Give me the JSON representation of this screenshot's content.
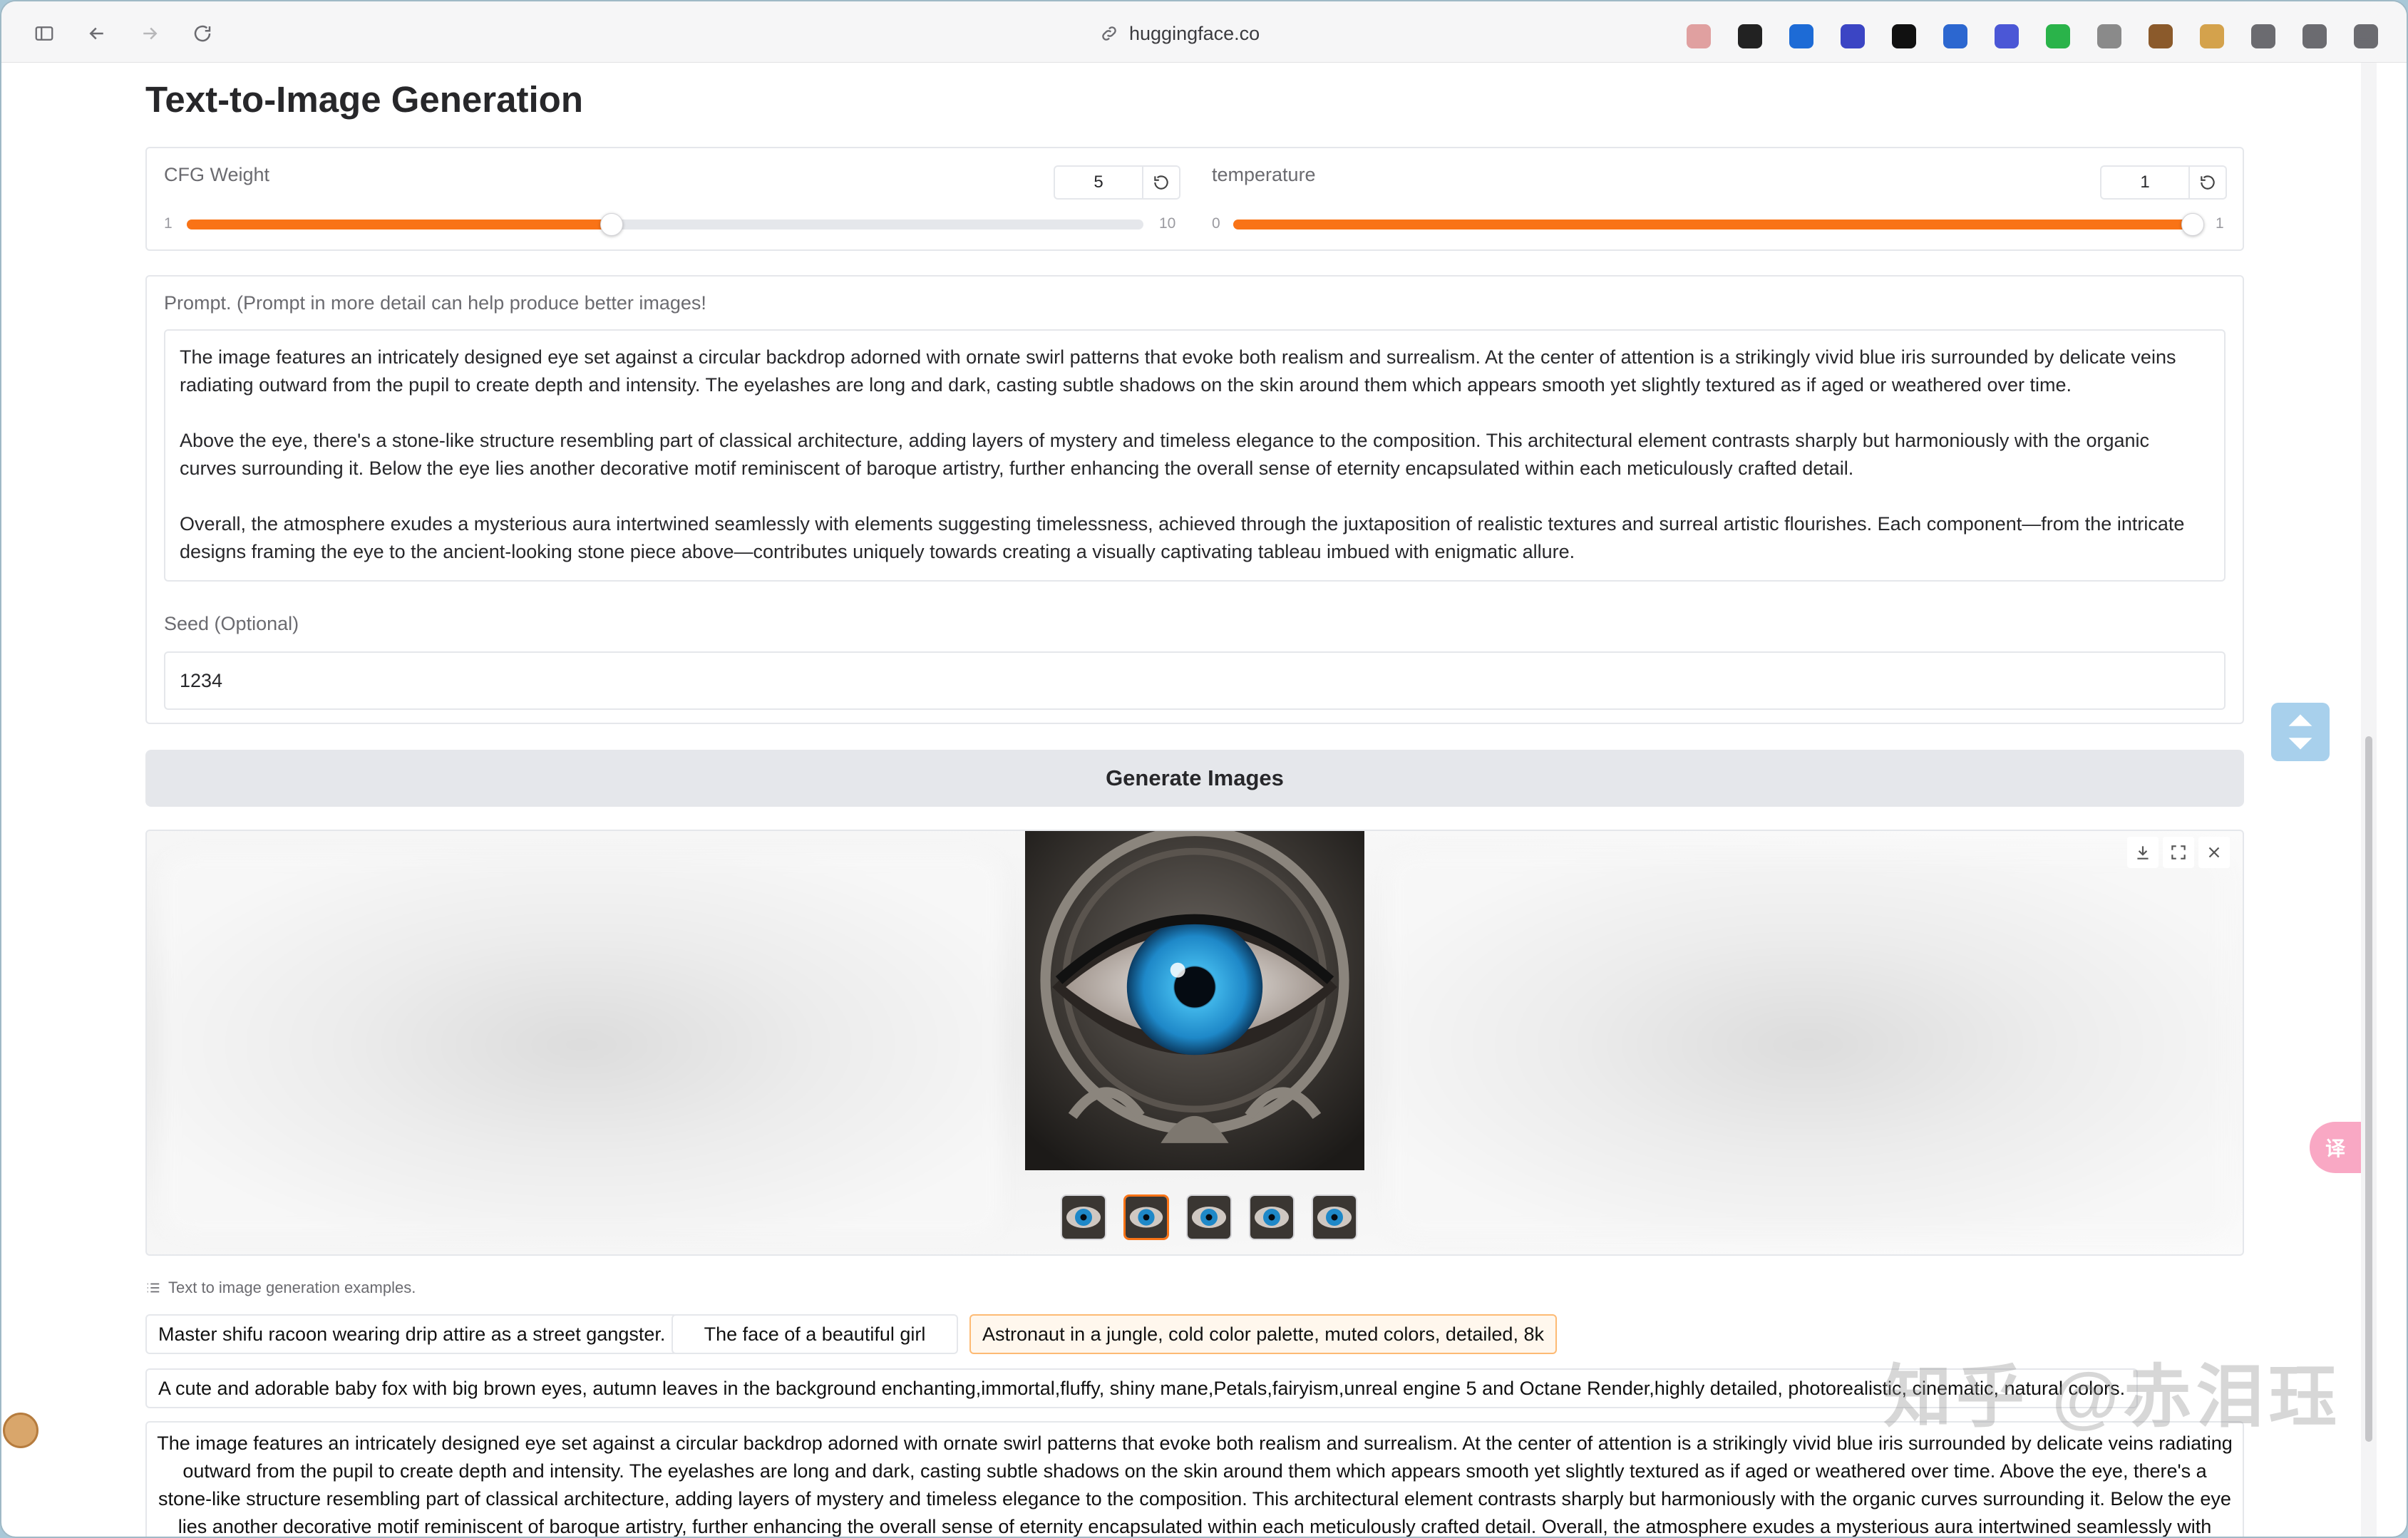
{
  "browser": {
    "url": "huggingface.co",
    "extension_colors": [
      "#e0a0a0",
      "#222222",
      "#1d6bd6",
      "#3b45c4",
      "#111111",
      "#2c67d0",
      "#4b57d6",
      "#2ab34a",
      "#8a8a8a",
      "#8b5a2b",
      "#d4a24c",
      "#6b6b70",
      "#6b6b70",
      "#6b6b70"
    ]
  },
  "page": {
    "title": "Text-to-Image Generation",
    "cfg": {
      "label": "CFG Weight",
      "value": "5",
      "min_label": "1",
      "max_label": "10",
      "min": 1,
      "max": 10,
      "current": 5
    },
    "temperature": {
      "label": "temperature",
      "value": "1",
      "min_label": "0",
      "max_label": "1",
      "min": 0,
      "max": 1,
      "current": 1
    },
    "prompt": {
      "label": "Prompt. (Prompt in more detail can help produce better images!",
      "paragraphs": [
        "The image features an intricately designed eye set against a circular backdrop adorned with ornate swirl patterns that evoke both realism and surrealism. At the center of attention is a strikingly vivid blue iris surrounded by delicate veins radiating outward from the pupil to create depth and intensity. The eyelashes are long and dark, casting subtle shadows on the skin around them which appears smooth yet slightly textured as if aged or weathered over time.",
        "Above the eye, there's a stone-like structure resembling part of classical architecture, adding layers of mystery and timeless elegance to the composition. This architectural element contrasts sharply but harmoniously with the organic curves surrounding it. Below the eye lies another decorative motif reminiscent of baroque artistry, further enhancing the overall sense of eternity encapsulated within each meticulously crafted detail.",
        "Overall, the atmosphere exudes a mysterious aura intertwined seamlessly with elements suggesting timelessness, achieved through the juxtaposition of realistic textures and surreal artistic flourishes. Each component—from the intricate designs framing the eye to the ancient-looking stone piece above—contributes uniquely towards creating a visually captivating tableau imbued with enigmatic allure."
      ]
    },
    "seed": {
      "label": "Seed (Optional)",
      "value": "1234"
    },
    "generate_label": "Generate Images",
    "gallery": {
      "selected_index": 1,
      "thumb_count": 5
    },
    "examples": {
      "title": "Text to image generation examples.",
      "items": [
        "Master shifu racoon wearing drip attire as a street gangster.",
        "The face of a beautiful girl",
        "Astronaut in a jungle, cold color palette, muted colors, detailed, 8k",
        "A cute and adorable baby fox with big brown eyes, autumn leaves in the background enchanting,immortal,fluffy, shiny mane,Petals,fairyism,unreal engine 5 and Octane Render,highly detailed, photorealistic, cinematic, natural colors."
      ],
      "long_item": "The image features an intricately designed eye set against a circular backdrop adorned with ornate swirl patterns that evoke both realism and surrealism. At the center of attention is a strikingly vivid blue iris surrounded by delicate veins radiating outward from the pupil to create depth and intensity. The eyelashes are long and dark, casting subtle shadows on the skin around them which appears smooth yet slightly textured as if aged or weathered over time. Above the eye, there's a stone-like structure resembling part of classical architecture, adding layers of mystery and timeless elegance to the composition. This architectural element contrasts sharply but harmoniously with the organic curves surrounding it. Below the eye lies another decorative motif reminiscent of baroque artistry, further enhancing the overall sense of eternity encapsulated within each meticulously crafted detail. Overall, the atmosphere exudes a mysterious aura intertwined seamlessly with elements suggesting"
    },
    "translate_label": "译",
    "watermark": "知乎 @赤泪珏"
  },
  "colors": {
    "accent": "#f97316",
    "iris": "#1e88c8"
  }
}
